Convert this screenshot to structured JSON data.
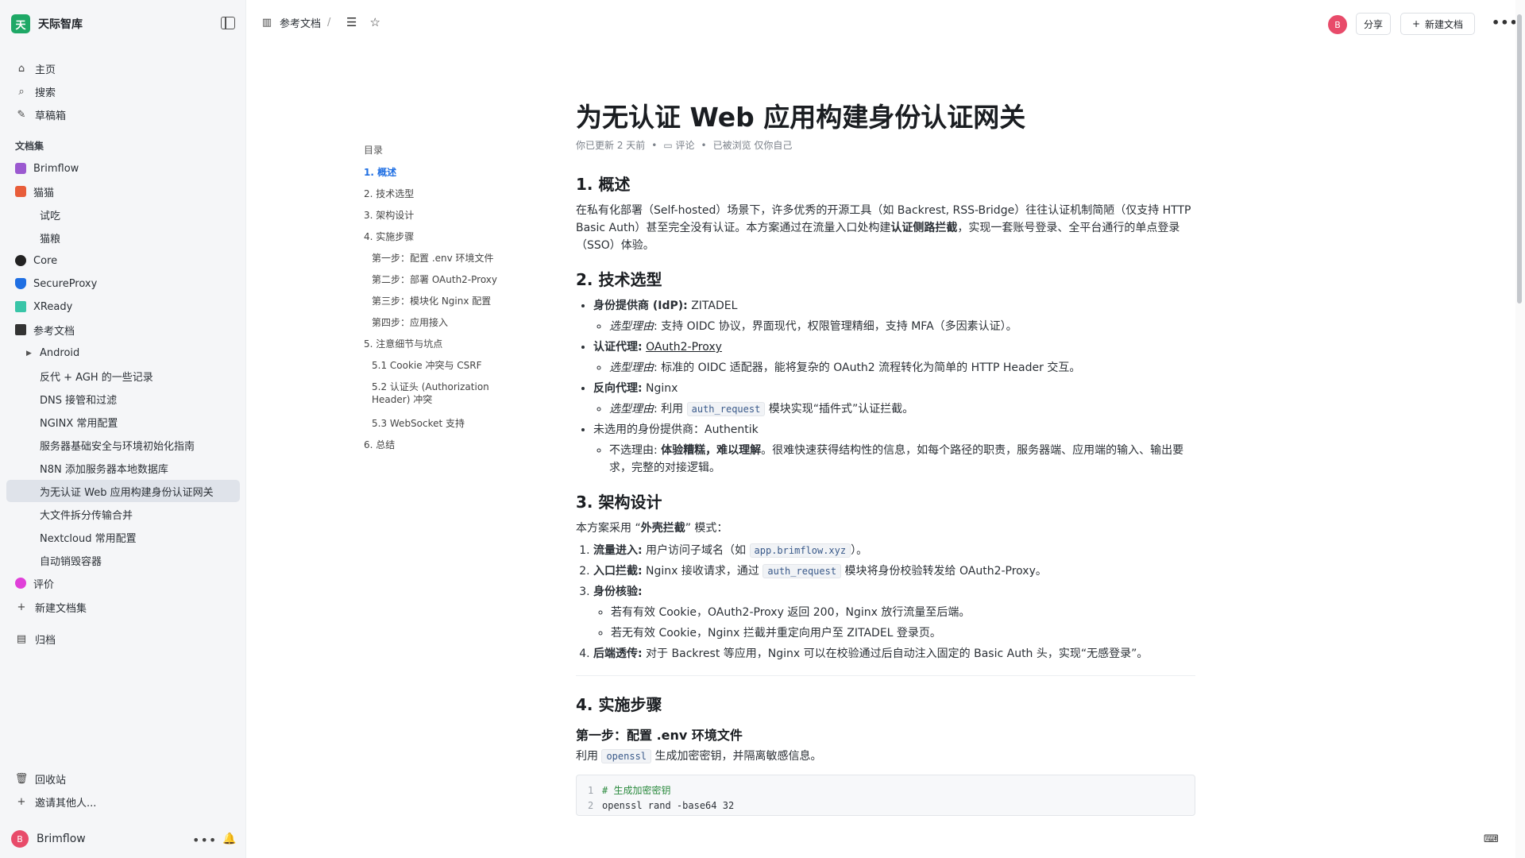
{
  "workspace": {
    "logo": "天",
    "name": "天际智库"
  },
  "nav": {
    "home": "主页",
    "search": "搜索",
    "drafts": "草稿箱"
  },
  "collections_label": "文档集",
  "collections": [
    {
      "label": "Brimflow",
      "color": "#9b59d0"
    },
    {
      "label": "猫猫",
      "color": "#e85d3a"
    },
    {
      "label": "试吃"
    },
    {
      "label": "猫粮"
    },
    {
      "label": "Core",
      "color": "#222222"
    },
    {
      "label": "SecureProxy",
      "color": "#1f6fe3"
    },
    {
      "label": "XReady",
      "color": "#39c5a8"
    },
    {
      "label": "参考文档",
      "color": "#333333"
    },
    {
      "label": "Android"
    },
    {
      "label": "反代 + AGH 的一些记录"
    },
    {
      "label": "DNS 接管和过滤"
    },
    {
      "label": "NGINX 常用配置"
    },
    {
      "label": "服务器基础安全与环境初始化指南"
    },
    {
      "label": "N8N 添加服务器本地数据库"
    },
    {
      "label": "为无认证 Web 应用构建身份认证网关"
    },
    {
      "label": "大文件拆分传输合并"
    },
    {
      "label": "Nextcloud 常用配置"
    },
    {
      "label": "自动销毁容器"
    },
    {
      "label": "评价",
      "color": "#e040d9"
    }
  ],
  "new_collection": "新建文档集",
  "archive": "归档",
  "trash": "回收站",
  "invite": "邀请其他人...",
  "user": {
    "initial": "B",
    "name": "Brimflow"
  },
  "header": {
    "breadcrumb": "参考文档",
    "breadcrumb_sep": "/",
    "avatar": "B",
    "share": "分享",
    "new_doc": "新建文档"
  },
  "toc": {
    "title": "目录",
    "items": [
      "1. 概述",
      "2. 技术选型",
      "3. 架构设计",
      "4. 实施步骤",
      "第一步：配置 .env 环境文件",
      "第二步：部署 OAuth2-Proxy",
      "第三步：模块化 Nginx 配置",
      "第四步：应用接入",
      "5. 注意细节与坑点",
      "5.1 Cookie 冲突与 CSRF",
      "5.2 认证头 (Authorization Header) 冲突",
      "5.3 WebSocket 支持",
      "6. 总结"
    ]
  },
  "doc": {
    "title": "为无认证 Web 应用构建身份认证网关",
    "meta": {
      "updated": "你已更新 2 天前",
      "comment": "评论",
      "viewed": "已被浏览 仅你自己"
    },
    "s1": {
      "h": "1. 概述",
      "p_a": "在私有化部署（Self-hosted）场景下，许多优秀的开源工具（如 Backrest, RSS-Bridge）往往认证机制简陋（仅支持 HTTP Basic Auth）甚至完全没有认证。本方案通过在流量入口处构建",
      "p_b": "认证侧路拦截",
      "p_c": "，实现一套账号登录、全平台通行的单点登录（SSO）体验。"
    },
    "s2": {
      "h": "2. 技术选型",
      "idp_label": "身份提供商 (IdP):",
      "idp_value": " ZITADEL",
      "reason_label": "选型理由",
      "idp_reason": ": 支持 OIDC 协议，界面现代，权限管理精细，支持 MFA（多因素认证）。",
      "proxy_label": "认证代理:",
      "proxy_value": "OAuth2-Proxy",
      "proxy_reason": ": 标准的 OIDC 适配器，能将复杂的 OAuth2 流程转化为简单的 HTTP Header 交互。",
      "rev_label": "反向代理:",
      "rev_value": " Nginx",
      "rev_reason_a": ": 利用 ",
      "rev_code": "auth_request",
      "rev_reason_b": " 模块实现“插件式”认证拦截。",
      "unused": "未选用的身份提供商：Authentik",
      "unused_reason_a": "不选理由: ",
      "unused_reason_b": "体验糟糕，难以理解",
      "unused_reason_c": "。很难快速获得结构性的信息，如每个路径的职责，服务器端、应用端的输入、输出要求，完整的对接逻辑。"
    },
    "s3": {
      "h": "3. 架构设计",
      "intro_a": "本方案采用 “",
      "intro_b": "外壳拦截",
      "intro_c": "” 模式：",
      "step1_label": "流量进入:",
      "step1_a": " 用户访问子域名（如 ",
      "step1_code": "app.brimflow.xyz",
      "step1_b": "）。",
      "step2_label": "入口拦截:",
      "step2_a": " Nginx 接收请求，通过 ",
      "step2_code": "auth_request",
      "step2_b": " 模块将身份校验转发给 OAuth2-Proxy。",
      "step3_label": "身份核验:",
      "step3_a": "若有有效 Cookie，OAuth2-Proxy 返回 200，Nginx 放行流量至后端。",
      "step3_b": "若无有效 Cookie，Nginx 拦截并重定向用户至 ZITADEL 登录页。",
      "step4_label": "后端透传:",
      "step4_text": " 对于 Backrest 等应用，Nginx 可以在校验通过后自动注入固定的 Basic Auth 头，实现“无感登录”。"
    },
    "s4": {
      "h": "4. 实施步骤",
      "sub1": "第一步：配置 .env 环境文件",
      "p_a": "利用 ",
      "p_code": "openssl",
      "p_b": " 生成加密密钥，并隔离敏感信息。",
      "code_l1_no": "1",
      "code_l1": "# 生成加密密钥",
      "code_l2_no": "2",
      "code_l2": "openssl rand -base64 32"
    }
  }
}
